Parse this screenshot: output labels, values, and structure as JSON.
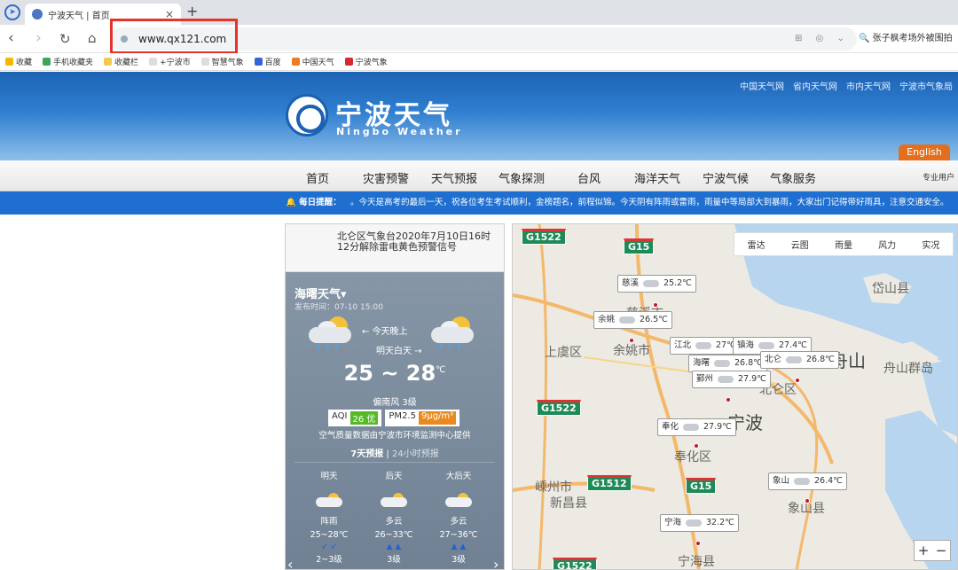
{
  "browser": {
    "tab_title": "宁波天气 | 首页",
    "url": "www.qx121.com",
    "search_text": "张子枫考场外被围拍",
    "bookmarks": [
      "收藏",
      "手机收藏夹",
      "收藏栏",
      "+宁波市",
      "智慧气象",
      "百度",
      "中国天气",
      "宁波气象"
    ]
  },
  "site": {
    "logo_title": "宁波天气",
    "logo_subtitle": "Ningbo Weather",
    "top_links": [
      "中国天气网",
      "省内天气网",
      "市内天气网",
      "宁波市气象局"
    ],
    "english": "English",
    "nav": [
      "首页",
      "灾害预警",
      "天气预报",
      "气象探测",
      "台风",
      "海洋天气",
      "宁波气候",
      "气象服务"
    ],
    "pro_user": "专业用户",
    "tip_label": "每日提醒：",
    "tip_text": "。今天是高考的最后一天，祝各位考生考试顺利，金榜题名，前程似锦。今天阴有阵雨或雷雨，雨量中等局部大到暴雨，大家出门记得带好雨具，注意交通安全。"
  },
  "panel": {
    "warning": "北仑区气象台2020年7月10日16时12分解除雷电黄色预警信号",
    "city": "海曙天气",
    "publish_time": "发布时间：07-10 15:00",
    "tonight": "← 今天晚上",
    "tomorrow_day": "明天白天 →",
    "temp_low": "25",
    "temp_sep": " ~ ",
    "temp_high": "28",
    "temp_unit": "℃",
    "wind": "偏南风 3级",
    "aqi_label": "AQI",
    "aqi_value": "26 优",
    "pm_label": "PM2.5",
    "pm_value": "9μg/m³",
    "aqi_color": "#55b928",
    "pm_color": "#e98a1f",
    "aqi_note": "空气质量数据由宁波市环境监测中心提供",
    "tab_7day": "7天预报",
    "tab_sep": "|",
    "tab_24h": "24小时预报",
    "forecast": [
      {
        "day": "明天",
        "cond": "阵雨",
        "temp": "25~28℃",
        "wind": "2~3级"
      },
      {
        "day": "后天",
        "cond": "多云",
        "temp": "26~33℃",
        "wind": "3级"
      },
      {
        "day": "大后天",
        "cond": "多云",
        "temp": "27~36℃",
        "wind": "3级"
      }
    ]
  },
  "map": {
    "tabs": [
      "雷达",
      "云图",
      "雨量",
      "风力",
      "实况"
    ],
    "roads": [
      "G1522",
      "G15",
      "G1522",
      "G1512",
      "G15",
      "G1522"
    ],
    "places": [
      "慈溪市",
      "余姚市",
      "上虞区",
      "北仑区",
      "宁波",
      "奉化区",
      "嵊州市",
      "新昌县",
      "象山县",
      "宁海县",
      "岱山县",
      "舟山群岛",
      "舟山"
    ],
    "stations": [
      {
        "name": "慈溪",
        "temp": "25.2℃"
      },
      {
        "name": "余姚",
        "temp": "26.5℃"
      },
      {
        "name": "江北",
        "temp": "27℃"
      },
      {
        "name": "镇海",
        "temp": "27.4℃"
      },
      {
        "name": "海曙",
        "temp": "26.8℃"
      },
      {
        "name": "北仑",
        "temp": "26.8℃"
      },
      {
        "name": "鄞州",
        "temp": "27.9℃"
      },
      {
        "name": "奉化",
        "temp": "27.9℃"
      },
      {
        "name": "象山",
        "temp": "26.4℃"
      },
      {
        "name": "宁海",
        "temp": "32.2℃"
      }
    ],
    "zoom_in": "+",
    "zoom_out": "−"
  }
}
